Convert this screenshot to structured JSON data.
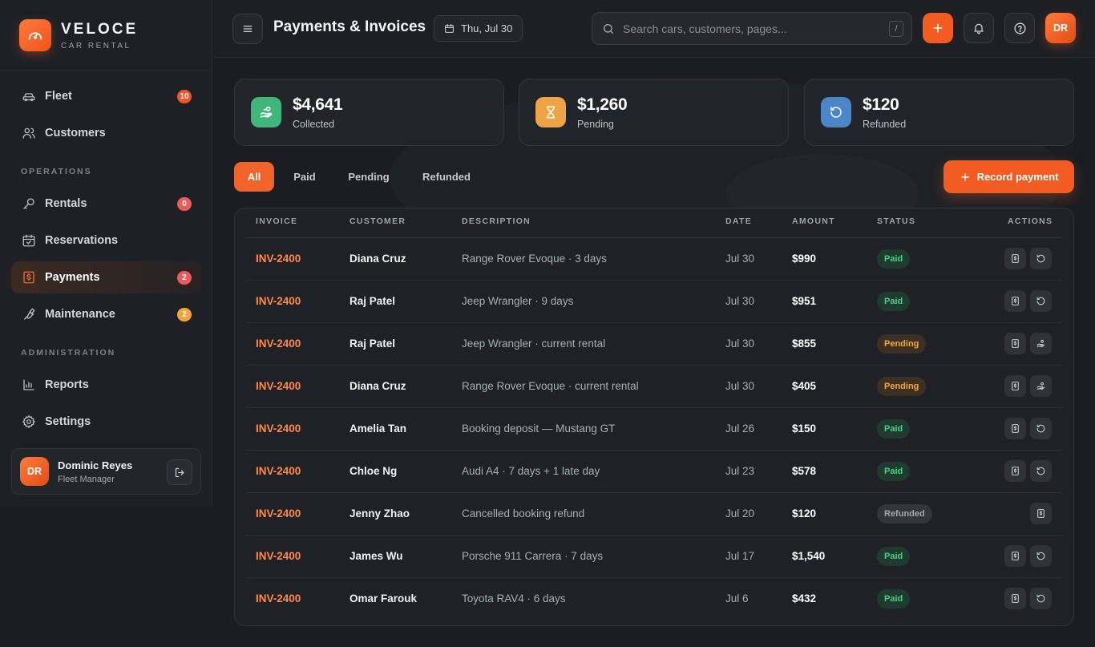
{
  "brand": {
    "name": "VELOCE",
    "sub": "CAR RENTAL"
  },
  "sidebar": {
    "items": [
      {
        "label": "Fleet",
        "badge": "10",
        "badge_color": "#f0552a"
      },
      {
        "label": "Customers",
        "badge": ""
      },
      {
        "label": "Rentals",
        "badge": "0",
        "badge_color": "#ec5b5b"
      },
      {
        "label": "Reservations",
        "badge": ""
      },
      {
        "label": "Payments",
        "badge": "2",
        "badge_color": "#ec5b5b"
      },
      {
        "label": "Maintenance",
        "badge": "2",
        "badge_color": "#f0a43a"
      },
      {
        "label": "Reports",
        "badge": ""
      },
      {
        "label": "Settings",
        "badge": ""
      }
    ],
    "sections": {
      "operations": "OPERATIONS",
      "administration": "ADMINISTRATION"
    },
    "user": {
      "initials": "DR",
      "name": "Dominic Reyes",
      "role": "Fleet Manager"
    }
  },
  "topbar": {
    "title": "Payments & Invoices",
    "date": "Thu, Jul 30",
    "search_placeholder": "Search cars, customers, pages...",
    "search_shortcut": "/",
    "avatar_initials": "DR"
  },
  "stats": [
    {
      "value": "$4,641",
      "label": "Collected",
      "color": "#3fb67a"
    },
    {
      "value": "$1,260",
      "label": "Pending",
      "color": "#eea344"
    },
    {
      "value": "$120",
      "label": "Refunded",
      "color": "#4a86c8"
    }
  ],
  "filters": {
    "all": "All",
    "paid": "Paid",
    "pending": "Pending",
    "refunded": "Refunded"
  },
  "record_button": "Record payment",
  "table": {
    "headers": [
      "INVOICE",
      "CUSTOMER",
      "DESCRIPTION",
      "DATE",
      "AMOUNT",
      "STATUS",
      "ACTIONS"
    ],
    "rows": [
      {
        "invoice": "INV-2400",
        "customer": "Diana Cruz",
        "description": "Range Rover Evoque · 3 days",
        "date": "Jul 30",
        "amount": "$990",
        "status": "Paid"
      },
      {
        "invoice": "INV-2400",
        "customer": "Raj Patel",
        "description": "Jeep Wrangler · 9 days",
        "date": "Jul 30",
        "amount": "$951",
        "status": "Paid"
      },
      {
        "invoice": "INV-2400",
        "customer": "Raj Patel",
        "description": "Jeep Wrangler · current rental",
        "date": "Jul 30",
        "amount": "$855",
        "status": "Pending"
      },
      {
        "invoice": "INV-2400",
        "customer": "Diana Cruz",
        "description": "Range Rover Evoque · current rental",
        "date": "Jul 30",
        "amount": "$405",
        "status": "Pending"
      },
      {
        "invoice": "INV-2400",
        "customer": "Amelia Tan",
        "description": "Booking deposit — Mustang GT",
        "date": "Jul 26",
        "amount": "$150",
        "status": "Paid"
      },
      {
        "invoice": "INV-2400",
        "customer": "Chloe Ng",
        "description": "Audi A4 · 7 days + 1 late day",
        "date": "Jul 23",
        "amount": "$578",
        "status": "Paid"
      },
      {
        "invoice": "INV-2400",
        "customer": "Jenny Zhao",
        "description": "Cancelled booking refund",
        "date": "Jul 20",
        "amount": "$120",
        "status": "Refunded"
      },
      {
        "invoice": "INV-2400",
        "customer": "James Wu",
        "description": "Porsche 911 Carrera · 7 days",
        "date": "Jul 17",
        "amount": "$1,540",
        "status": "Paid"
      },
      {
        "invoice": "INV-2400",
        "customer": "Omar Farouk",
        "description": "Toyota RAV4 · 6 days",
        "date": "Jul 6",
        "amount": "$432",
        "status": "Paid"
      }
    ]
  }
}
